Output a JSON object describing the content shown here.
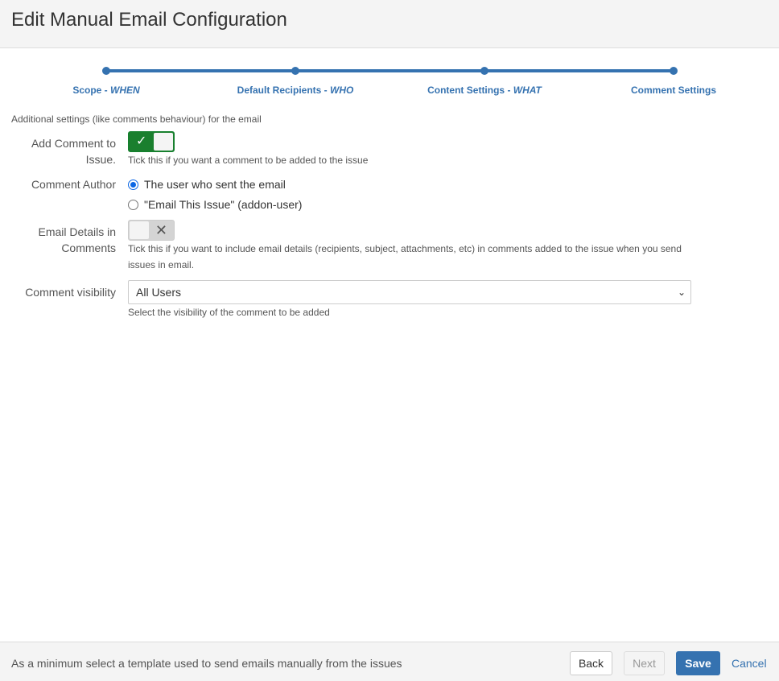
{
  "header": {
    "title": "Edit Manual Email Configuration"
  },
  "wizard": {
    "steps": [
      {
        "label": "Scope - ",
        "emph": "WHEN"
      },
      {
        "label": "Default Recipients - ",
        "emph": "WHO"
      },
      {
        "label": "Content Settings - ",
        "emph": "WHAT"
      },
      {
        "label": "Comment Settings",
        "emph": ""
      }
    ],
    "active_step": 4
  },
  "intro": "Additional settings (like comments behaviour) for the email",
  "form": {
    "add_comment": {
      "label_line1": "Add Comment to",
      "label_line2": "Issue.",
      "checked": true,
      "help": "Tick this if you want a comment to be added to the issue"
    },
    "comment_author": {
      "label": "Comment Author",
      "options": [
        {
          "label": "The user who sent the email",
          "checked": true
        },
        {
          "label": "\"Email This Issue\" (addon-user)",
          "checked": false
        }
      ]
    },
    "email_details": {
      "label_line1": "Email Details in",
      "label_line2": "Comments",
      "checked": false,
      "help_line1": "Tick this if you want to include email details (recipients, subject, attachments, etc) in comments added to the issue when you send",
      "help_line2": "issues in email."
    },
    "visibility": {
      "label": "Comment visibility",
      "value": "All Users",
      "help": "Select the visibility of the comment to be added"
    }
  },
  "footer": {
    "hint": "As a minimum select a template used to send emails manually from the issues",
    "back": "Back",
    "next": "Next",
    "save": "Save",
    "cancel": "Cancel"
  },
  "colors": {
    "accent": "#3572b0",
    "toggle_on": "#1a7f2e"
  }
}
